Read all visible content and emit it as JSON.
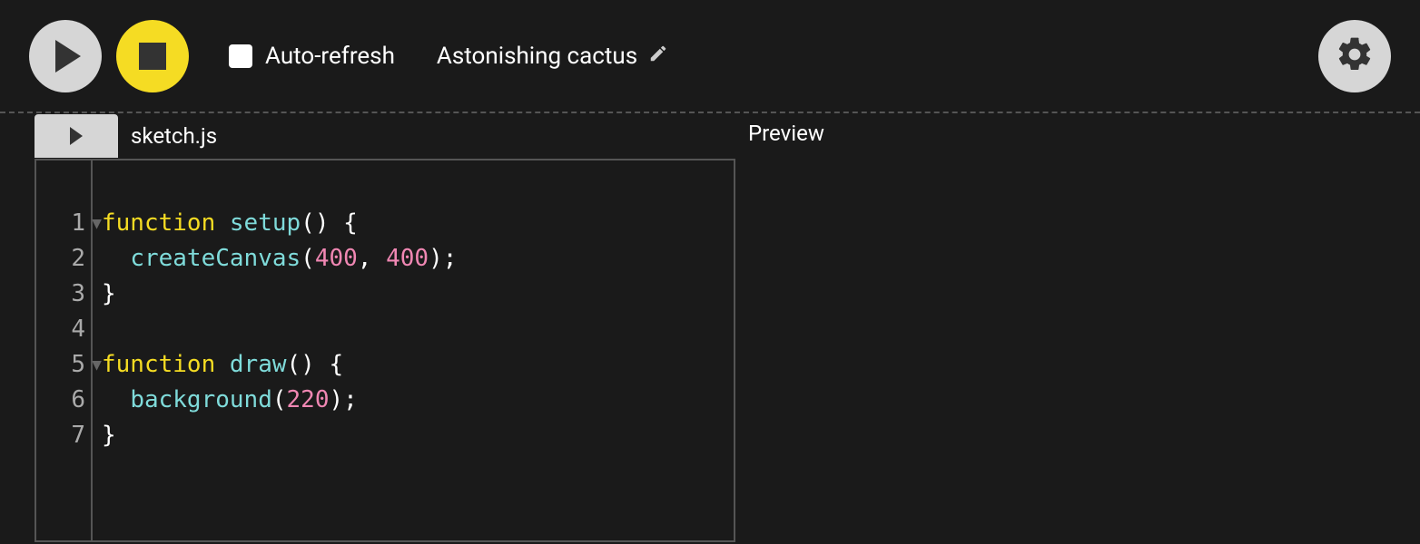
{
  "toolbar": {
    "auto_refresh_label": "Auto-refresh",
    "auto_refresh_checked": false,
    "sketch_name": "Astonishing cactus"
  },
  "editor": {
    "file_name": "sketch.js",
    "lines": [
      {
        "n": "1",
        "foldable": true,
        "tokens": [
          [
            "kw",
            "function"
          ],
          [
            "punct",
            " "
          ],
          [
            "fn",
            "setup"
          ],
          [
            "punct",
            "() {"
          ]
        ]
      },
      {
        "n": "2",
        "foldable": false,
        "tokens": [
          [
            "punct",
            "  "
          ],
          [
            "fn",
            "createCanvas"
          ],
          [
            "punct",
            "("
          ],
          [
            "num",
            "400"
          ],
          [
            "punct",
            ", "
          ],
          [
            "num",
            "400"
          ],
          [
            "punct",
            ");"
          ]
        ]
      },
      {
        "n": "3",
        "foldable": false,
        "tokens": [
          [
            "punct",
            "}"
          ]
        ]
      },
      {
        "n": "4",
        "foldable": false,
        "tokens": [
          [
            "punct",
            ""
          ]
        ]
      },
      {
        "n": "5",
        "foldable": true,
        "tokens": [
          [
            "kw",
            "function"
          ],
          [
            "punct",
            " "
          ],
          [
            "fn",
            "draw"
          ],
          [
            "punct",
            "() {"
          ]
        ]
      },
      {
        "n": "6",
        "foldable": false,
        "tokens": [
          [
            "punct",
            "  "
          ],
          [
            "fn",
            "background"
          ],
          [
            "punct",
            "("
          ],
          [
            "num",
            "220"
          ],
          [
            "punct",
            ");"
          ]
        ]
      },
      {
        "n": "7",
        "foldable": false,
        "tokens": [
          [
            "punct",
            "}"
          ]
        ]
      }
    ]
  },
  "preview": {
    "title": "Preview"
  },
  "colors": {
    "bg": "#1a1a1a",
    "accent_yellow": "#f5dc23",
    "button_grey": "#d6d6d6",
    "keyword": "#f5dc23",
    "function": "#7fdbda",
    "number": "#f087b3"
  }
}
